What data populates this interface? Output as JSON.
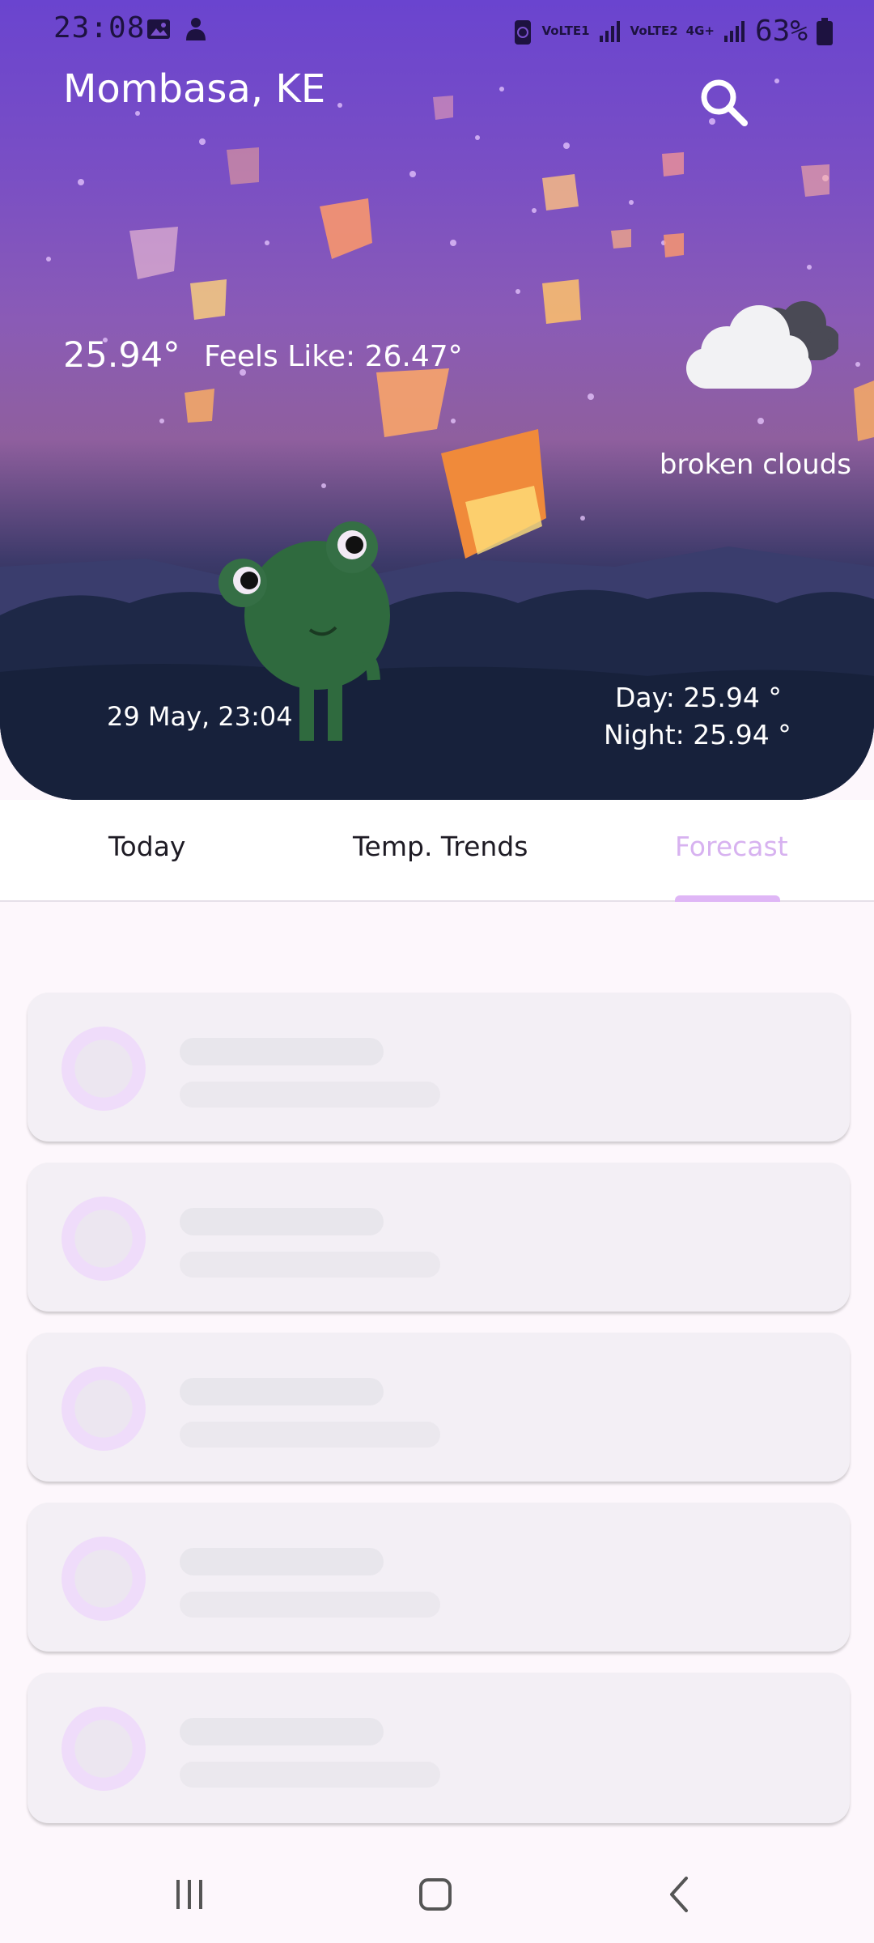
{
  "status_bar": {
    "time": "23:08",
    "sim1_label": "VoLTE1",
    "sim2_label": "VoLTE2",
    "network": "4G+",
    "battery": "63%"
  },
  "header": {
    "city": "Mombasa, KE",
    "search_icon": "search-icon"
  },
  "weather": {
    "temperature": "25.94°",
    "feels_like": "Feels Like: 26.47°",
    "condition": "broken clouds",
    "condition_icon": "broken-clouds-icon",
    "date_time": "29 May, 23:04",
    "day_temp": "Day: 25.94 °",
    "night_temp": "Night: 25.94 °"
  },
  "tabs": [
    {
      "label": "Today",
      "active": false
    },
    {
      "label": "Temp. Trends",
      "active": false
    },
    {
      "label": "Forecast",
      "active": true
    }
  ],
  "loading_cards": 5,
  "colors": {
    "accent": "#dfb6f6",
    "hero_top": "#6a44cf",
    "hero_bottom": "#15203a",
    "card_bg": "#f3eff5"
  },
  "navigation": {
    "recents_icon": "recents-icon",
    "home_icon": "home-icon",
    "back_icon": "back-icon"
  }
}
